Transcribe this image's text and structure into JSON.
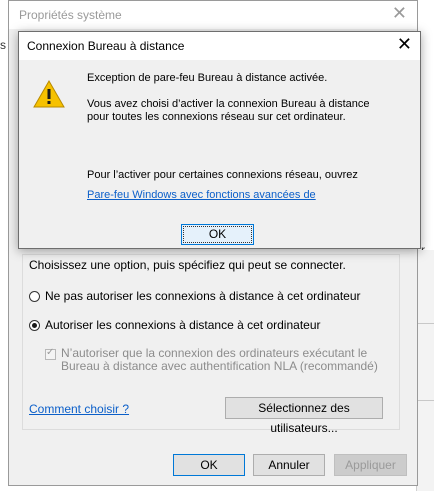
{
  "background": {
    "left_fragment": "s e",
    "right_fragment": "r 2"
  },
  "system_properties": {
    "title": "Propriétés système",
    "close_glyph": "✕",
    "remote": {
      "choose_text": "Choisissez une option, puis spécifiez qui peut se connecter.",
      "option_no": "Ne pas autoriser les connexions à distance à cet ordinateur",
      "option_yes": "Autoriser les connexions à distance à cet ordinateur",
      "nla_label": "N’autoriser que la connexion des ordinateurs exécutant le Bureau à distance avec authentification NLA (recommandé)",
      "help_link": "Comment choisir ?",
      "select_users_button": "Sélectionnez des utilisateurs..."
    },
    "buttons": {
      "ok": "OK",
      "cancel": "Annuler",
      "apply": "Appliquer"
    }
  },
  "dialog": {
    "title": "Connexion Bureau à distance",
    "close_glyph": "✕",
    "icon": "warning-icon",
    "heading": "Exception de pare-feu Bureau à distance activée.",
    "body": "Vous avez choisi d’activer la connexion Bureau à distance pour toutes les connexions réseau sur cet ordinateur.",
    "activate_text": "Pour l’activer pour certaines connexions réseau, ouvrez",
    "firewall_link": "Pare-feu Windows avec fonctions avancées de",
    "ok_button": "OK"
  },
  "colors": {
    "link": "#0b5fc9",
    "focus_border": "#0078d7",
    "warning_yellow": "#f6c100"
  }
}
